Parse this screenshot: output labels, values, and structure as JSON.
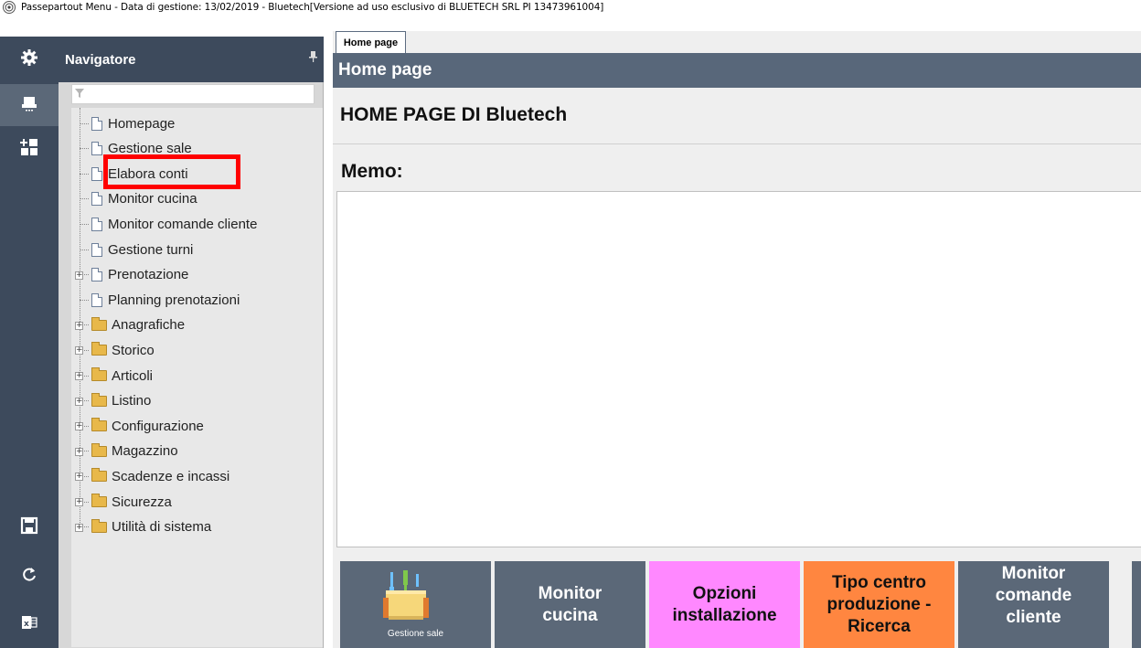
{
  "window": {
    "title": "Passepartout Menu - Data di gestione: 13/02/2019 - Bluetech[Versione ad uso esclusivo di BLUETECH SRL PI 13473961004]"
  },
  "leftbar": {
    "buttons": [
      {
        "icon": "gear-icon"
      },
      {
        "icon": "register-icon"
      },
      {
        "icon": "dashboard-add-icon"
      },
      {
        "icon": "save-icon"
      },
      {
        "icon": "refresh-icon"
      },
      {
        "icon": "excel-icon"
      }
    ],
    "active_color": "#5b6878"
  },
  "navigator": {
    "title": "Navigatore",
    "filter_value": "",
    "items": [
      {
        "label": "Homepage",
        "type": "doc",
        "expandable": false
      },
      {
        "label": "Gestione sale",
        "type": "doc",
        "expandable": false
      },
      {
        "label": "Elabora conti",
        "type": "doc",
        "expandable": false
      },
      {
        "label": "Monitor cucina",
        "type": "doc",
        "expandable": false
      },
      {
        "label": "Monitor comande cliente",
        "type": "doc",
        "expandable": false
      },
      {
        "label": "Gestione turni",
        "type": "doc",
        "expandable": false
      },
      {
        "label": "Prenotazione",
        "type": "doc",
        "expandable": true
      },
      {
        "label": "Planning prenotazioni",
        "type": "doc",
        "expandable": false
      },
      {
        "label": "Anagrafiche",
        "type": "folder",
        "expandable": true
      },
      {
        "label": "Storico",
        "type": "folder",
        "expandable": true
      },
      {
        "label": "Articoli",
        "type": "folder",
        "expandable": true
      },
      {
        "label": "Listino",
        "type": "folder",
        "expandable": true
      },
      {
        "label": "Configurazione",
        "type": "folder",
        "expandable": true
      },
      {
        "label": "Magazzino",
        "type": "folder",
        "expandable": true
      },
      {
        "label": "Scadenze e incassi",
        "type": "folder",
        "expandable": true
      },
      {
        "label": "Sicurezza",
        "type": "folder",
        "expandable": true
      },
      {
        "label": "Utilità di sistema",
        "type": "folder",
        "expandable": true
      }
    ],
    "highlight_color": "#ff0000"
  },
  "main": {
    "tab_label": "Home page",
    "header": "Home page",
    "page_title": "HOME PAGE DI Bluetech",
    "memo_label": "Memo:",
    "memo_value": "",
    "tiles": [
      {
        "label": "",
        "caption": "Gestione sale",
        "style": "gray",
        "icon": "dining-table-icon"
      },
      {
        "label": "Monitor cucina",
        "caption": "",
        "style": "gray"
      },
      {
        "label": "Opzioni installazione",
        "caption": "",
        "style": "pink"
      },
      {
        "label": "Tipo centro produzione - Ricerca",
        "caption": "",
        "style": "orange"
      },
      {
        "label": "Monitor comande cliente",
        "caption": "",
        "style": "gray"
      }
    ],
    "colors": {
      "header": "#58677a",
      "tile_gray": "#5b6878",
      "tile_pink": "#ff88ff",
      "tile_orange": "#ff8640"
    }
  }
}
